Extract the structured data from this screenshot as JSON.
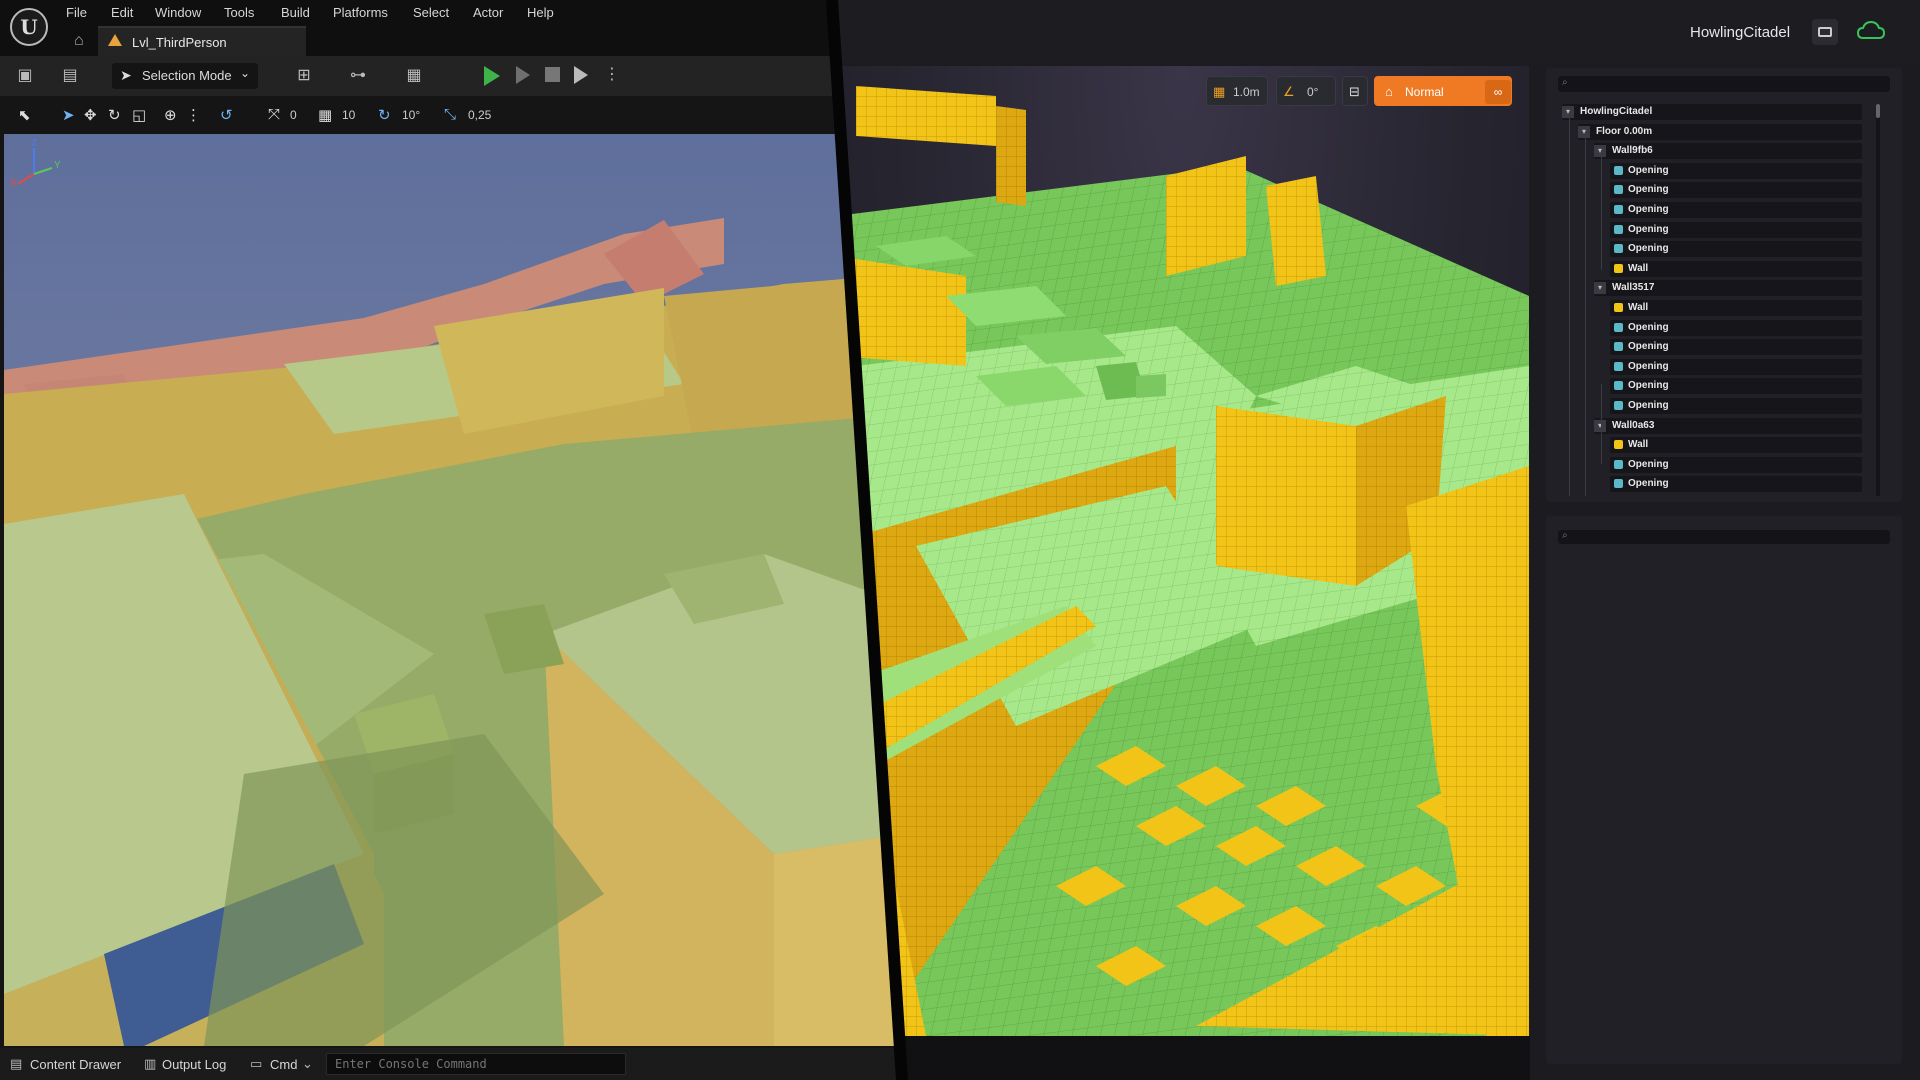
{
  "unreal": {
    "menu": [
      "File",
      "Edit",
      "Window",
      "Tools",
      "Build",
      "Platforms",
      "Select",
      "Actor",
      "Help"
    ],
    "level_tab": "Lvl_ThirdPerson",
    "selection_mode": "Selection Mode",
    "viewport_toolbar": {
      "rotate_snap": "0",
      "grid_snap": "10",
      "angle_snap": "10°",
      "scale_snap": "0,25"
    },
    "bottom": {
      "content_drawer": "Content Drawer",
      "output_log": "Output Log",
      "cmd": "Cmd",
      "console_placeholder": "Enter Console Command"
    },
    "gizmo": {
      "x": "X",
      "y": "Y",
      "z": "Z"
    }
  },
  "editor": {
    "project_name": "HowlingCitadel",
    "controls": {
      "grid_size": "1.0m",
      "angle": "0°",
      "mode": "Normal"
    },
    "outliner": {
      "search_placeholder": "",
      "items": [
        {
          "label": "HowlingCitadel",
          "depth": 0,
          "kind": "root",
          "expanded": true
        },
        {
          "label": "Floor 0.00m",
          "depth": 1,
          "kind": "floor",
          "expanded": true
        },
        {
          "label": "Wall9fb6",
          "depth": 2,
          "kind": "group",
          "expanded": true
        },
        {
          "label": "Opening",
          "depth": 3,
          "kind": "opening"
        },
        {
          "label": "Opening",
          "depth": 3,
          "kind": "opening"
        },
        {
          "label": "Opening",
          "depth": 3,
          "kind": "opening"
        },
        {
          "label": "Opening",
          "depth": 3,
          "kind": "opening"
        },
        {
          "label": "Opening",
          "depth": 3,
          "kind": "opening"
        },
        {
          "label": "Wall",
          "depth": 3,
          "kind": "wall"
        },
        {
          "label": "Wall3517",
          "depth": 2,
          "kind": "group",
          "expanded": true
        },
        {
          "label": "Wall",
          "depth": 3,
          "kind": "wall"
        },
        {
          "label": "Opening",
          "depth": 3,
          "kind": "opening"
        },
        {
          "label": "Opening",
          "depth": 3,
          "kind": "opening"
        },
        {
          "label": "Opening",
          "depth": 3,
          "kind": "opening"
        },
        {
          "label": "Opening",
          "depth": 3,
          "kind": "opening"
        },
        {
          "label": "Opening",
          "depth": 3,
          "kind": "opening"
        },
        {
          "label": "Wall0a63",
          "depth": 2,
          "kind": "group",
          "expanded": true
        },
        {
          "label": "Wall",
          "depth": 3,
          "kind": "wall"
        },
        {
          "label": "Opening",
          "depth": 3,
          "kind": "opening"
        },
        {
          "label": "Opening",
          "depth": 3,
          "kind": "opening"
        }
      ]
    },
    "colors": {
      "accent": "#f07a23",
      "cloud": "#36c45a",
      "wall": "#f2c418",
      "floor": "#9fe07a"
    }
  }
}
